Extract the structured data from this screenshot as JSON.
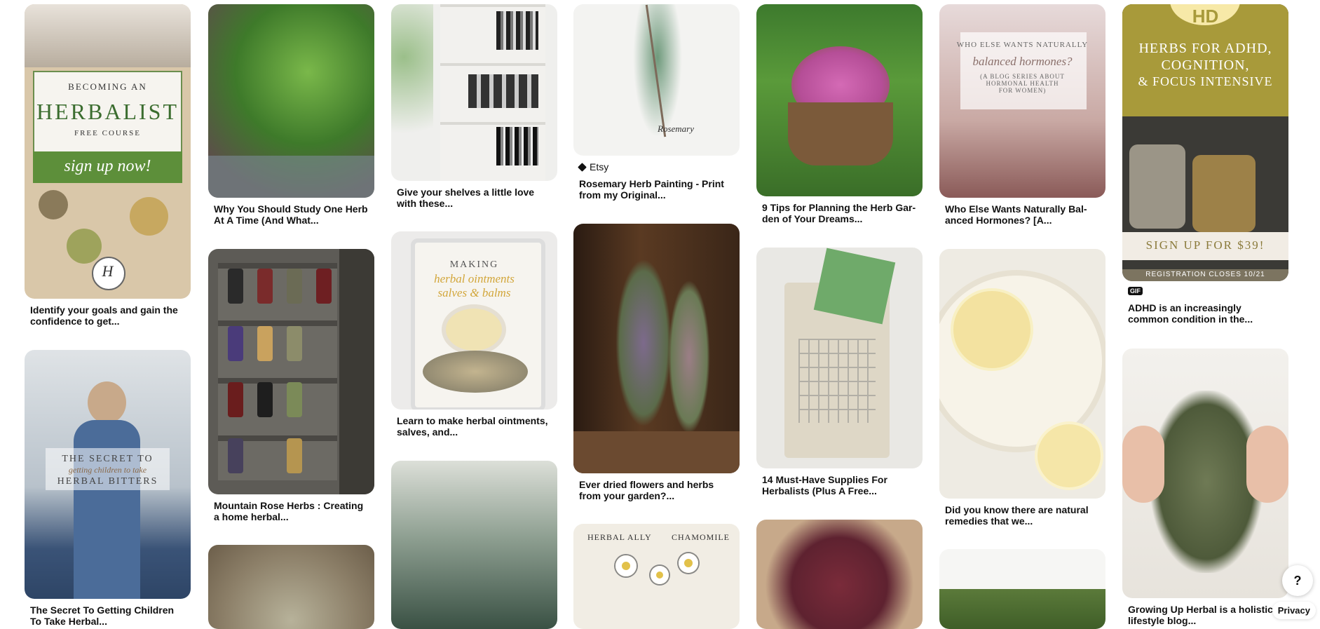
{
  "pins": [
    {
      "title": "Identify your goals and gain the confidence to get..."
    },
    {
      "title": "The Secret To Getting Children To Take Herbal..."
    },
    {
      "title": "Why You Should Study One Herb At A Time (And What..."
    },
    {
      "title": "Mountain Rose Herbs : Creating a home herbal..."
    },
    {
      "title": "Give your shelves a little love with these..."
    },
    {
      "title": "Learn to make herbal ointments, salves, and..."
    },
    {
      "title": "Rosemary Herb Painting - Print from my Original...",
      "source": "Etsy"
    },
    {
      "title": "Ever dried flowers and herbs from your garden?..."
    },
    {
      "title": "9 Tips for Planning the Herb Gar-den of Your Dreams..."
    },
    {
      "title": "14 Must-Have Supplies For Herbalists (Plus A Free..."
    },
    {
      "title": "Who Else Wants Naturally Bal-anced Hormones? [A..."
    },
    {
      "title": "Did you know there are natural remedies that we..."
    },
    {
      "title": "ADHD is an increasingly common condition in the...",
      "badge": "GIF"
    },
    {
      "title": "Growing Up Herbal is a holistic lifestyle blog..."
    }
  ],
  "image_text": {
    "herbalist_1": "BECOMING AN",
    "herbalist_2": "HERBALIST",
    "herbalist_3": "FREE COURSE",
    "herbalist_4": "sign up now!",
    "herbalist_5": "H",
    "bitters_1": "THE SECRET TO",
    "bitters_2": "getting children to take",
    "bitters_3": "HERBAL BITTERS",
    "ointment_1": "MAKING",
    "ointment_2": "herbal ointments",
    "ointment_3": "salves & balms",
    "rosemary": "Rosemary",
    "hormones_1": "WHO ELSE WANTS NATURALLY",
    "hormones_2": "balanced hormones?",
    "hormones_3": "(A BLOG SERIES ABOUT HORMONAL HEALTH FOR WOMEN)",
    "adhd_1": "HD",
    "adhd_2": "HERBS FOR ADHD,",
    "adhd_3": "COGNITION,",
    "adhd_4": "& FOCUS INTENSIVE",
    "adhd_5": "SIGN UP FOR $39!",
    "adhd_6": "REGISTRATION CLOSES 10/21",
    "chamomile_1": "HERBAL ALLY",
    "chamomile_2": "CHAMOMILE"
  },
  "controls": {
    "help": "?",
    "privacy": "Privacy"
  }
}
